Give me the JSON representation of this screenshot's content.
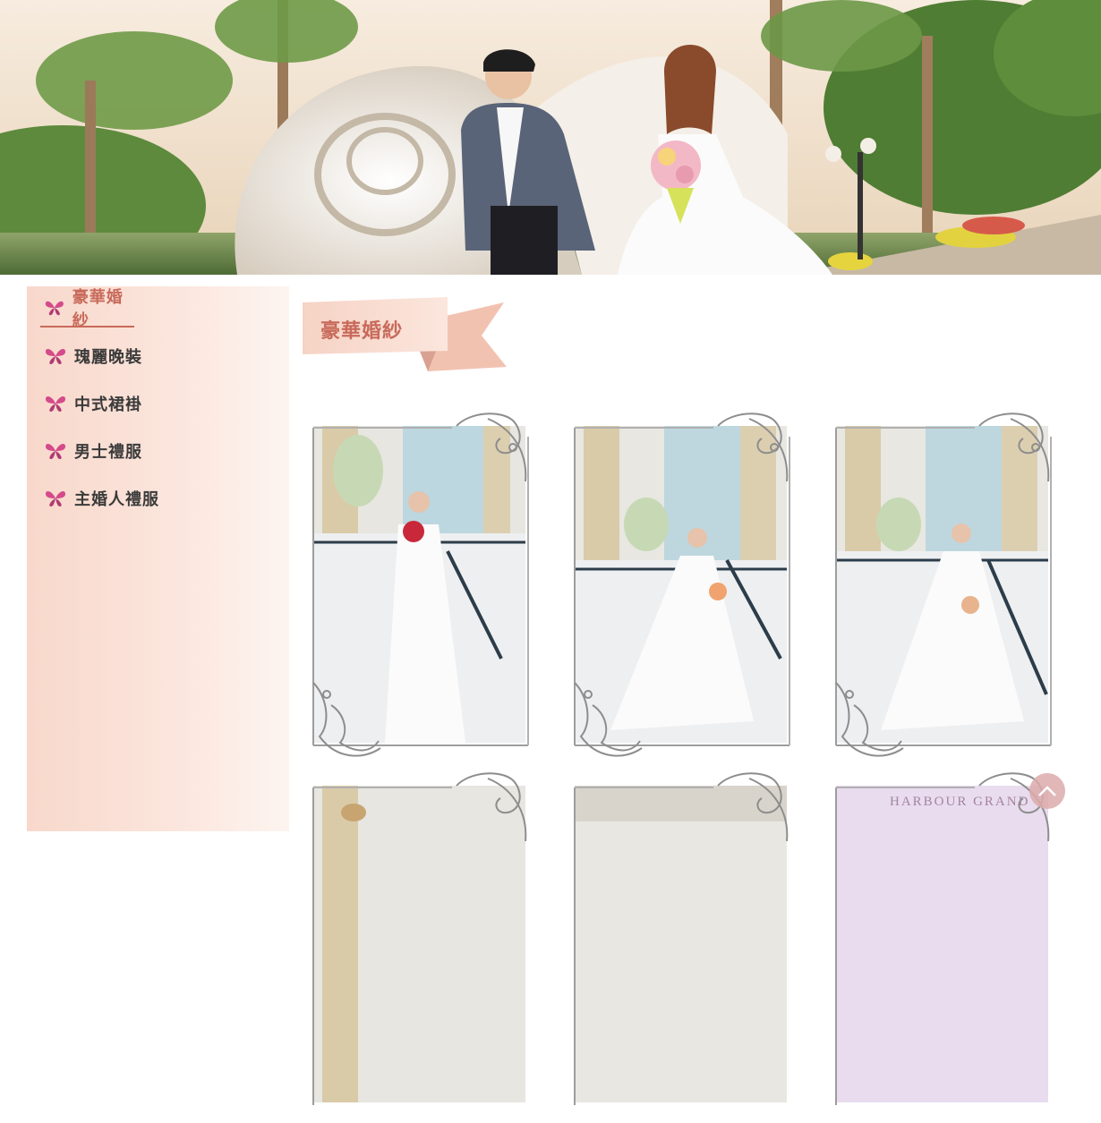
{
  "hero": {
    "alt": "Wedding couple banner"
  },
  "sidebar": {
    "items": [
      {
        "label": "豪華婚紗",
        "active": true
      },
      {
        "label": "瑰麗晚裝",
        "active": false
      },
      {
        "label": "中式裙褂",
        "active": false
      },
      {
        "label": "男士禮服",
        "active": false
      },
      {
        "label": "主婚人禮服",
        "active": false
      }
    ]
  },
  "content": {
    "title": "豪華婚紗"
  },
  "gallery": {
    "row2_third_caption": "HARBOUR GRAND"
  },
  "colors": {
    "accent": "#c86a5a",
    "sidebar_bg": "#fbe5dc",
    "butterfly": "#d44a8a"
  },
  "icons": {
    "side_icon": "butterfly-icon",
    "back_to_top": "chevron-up-icon"
  }
}
